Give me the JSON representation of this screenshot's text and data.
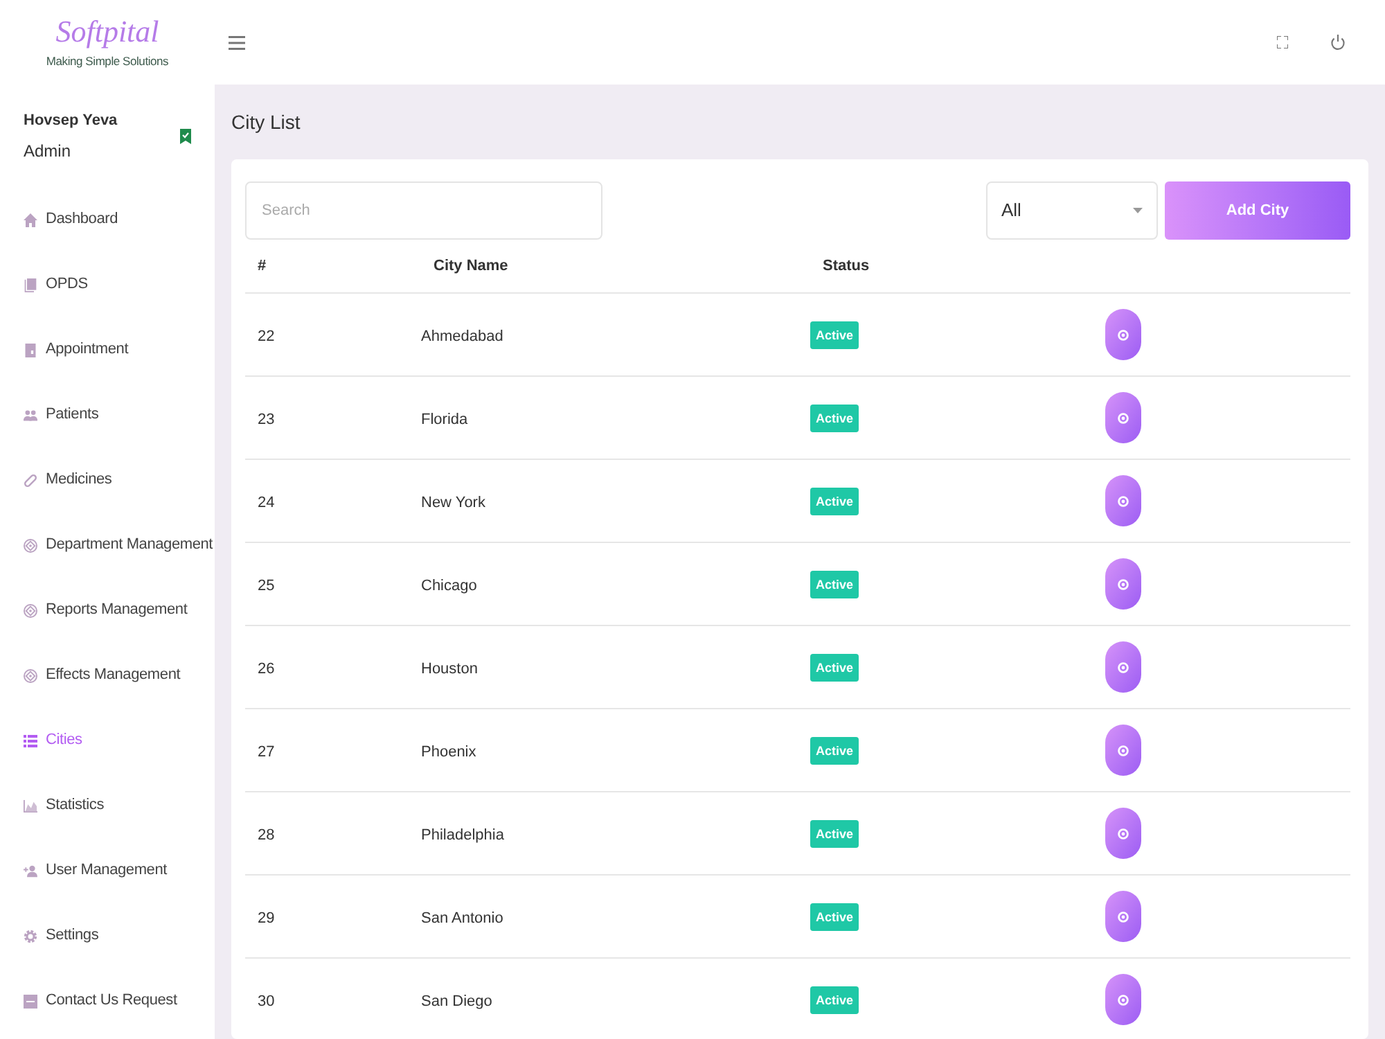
{
  "logo": {
    "title": "Softpital",
    "tagline": "Making Simple Solutions"
  },
  "user": {
    "name": "Hovsep Yeva",
    "role": "Admin"
  },
  "sidebar": {
    "items": [
      {
        "label": "Dashboard",
        "kind": "home",
        "selected": false
      },
      {
        "label": "OPDS",
        "kind": "book",
        "selected": false
      },
      {
        "label": "Appointment",
        "kind": "clipboard",
        "selected": false
      },
      {
        "label": "Patients",
        "kind": "people",
        "selected": false
      },
      {
        "label": "Medicines",
        "kind": "pill",
        "selected": false
      },
      {
        "label": "Department Management",
        "kind": "module",
        "selected": false
      },
      {
        "label": "Reports Management",
        "kind": "module",
        "selected": false
      },
      {
        "label": "Effects Management",
        "kind": "module",
        "selected": false
      },
      {
        "label": "Cities",
        "kind": "list",
        "selected": true
      },
      {
        "label": "Statistics",
        "kind": "chart",
        "selected": false
      },
      {
        "label": "User Management",
        "kind": "user",
        "selected": false
      },
      {
        "label": "Settings",
        "kind": "gear",
        "selected": false
      },
      {
        "label": "Contact Us Request",
        "kind": "note",
        "selected": false
      }
    ]
  },
  "page": {
    "title": "City List"
  },
  "toolbar": {
    "search": {
      "placeholder": "Search"
    },
    "filter": {
      "value": "All"
    },
    "add_button": {
      "label": "Add City"
    }
  },
  "table": {
    "columns": [
      "#",
      "City Name",
      "Status"
    ],
    "rows": [
      {
        "id": "22",
        "city": "Ahmedabad",
        "status": "Active"
      },
      {
        "id": "23",
        "city": "Florida",
        "status": "Active"
      },
      {
        "id": "24",
        "city": "New York",
        "status": "Active"
      },
      {
        "id": "25",
        "city": "Chicago",
        "status": "Active"
      },
      {
        "id": "26",
        "city": "Houston",
        "status": "Active"
      },
      {
        "id": "27",
        "city": "Phoenix",
        "status": "Active"
      },
      {
        "id": "28",
        "city": "Philadelphia",
        "status": "Active"
      },
      {
        "id": "29",
        "city": "San Antonio",
        "status": "Active"
      },
      {
        "id": "30",
        "city": "San Diego",
        "status": "Active"
      }
    ]
  }
}
